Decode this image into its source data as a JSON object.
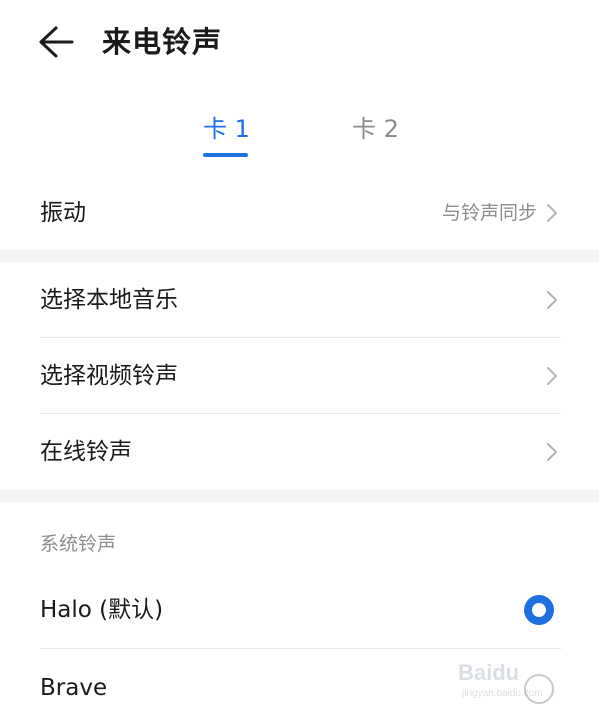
{
  "header": {
    "title": "来电铃声",
    "back_icon": "arrow-left-icon"
  },
  "tabs": [
    {
      "label": "卡 1",
      "active": true
    },
    {
      "label": "卡 2",
      "active": false
    }
  ],
  "vibration": {
    "label": "振动",
    "value": "与铃声同步"
  },
  "menu": [
    {
      "label": "选择本地音乐"
    },
    {
      "label": "选择视频铃声"
    },
    {
      "label": "在线铃声"
    }
  ],
  "system_ringtones": {
    "title": "系统铃声",
    "items": [
      {
        "label": "Halo (默认)",
        "selected": true
      },
      {
        "label": "Brave",
        "selected": false
      }
    ]
  },
  "watermark": {
    "brand": "Baidu",
    "sub": "jingyan.baidu.com"
  },
  "colors": {
    "accent": "#1f6fe0",
    "secondary_text": "#8d8d8d",
    "divider": "#e6e6e6",
    "section_gap": "#f4f4f4"
  }
}
